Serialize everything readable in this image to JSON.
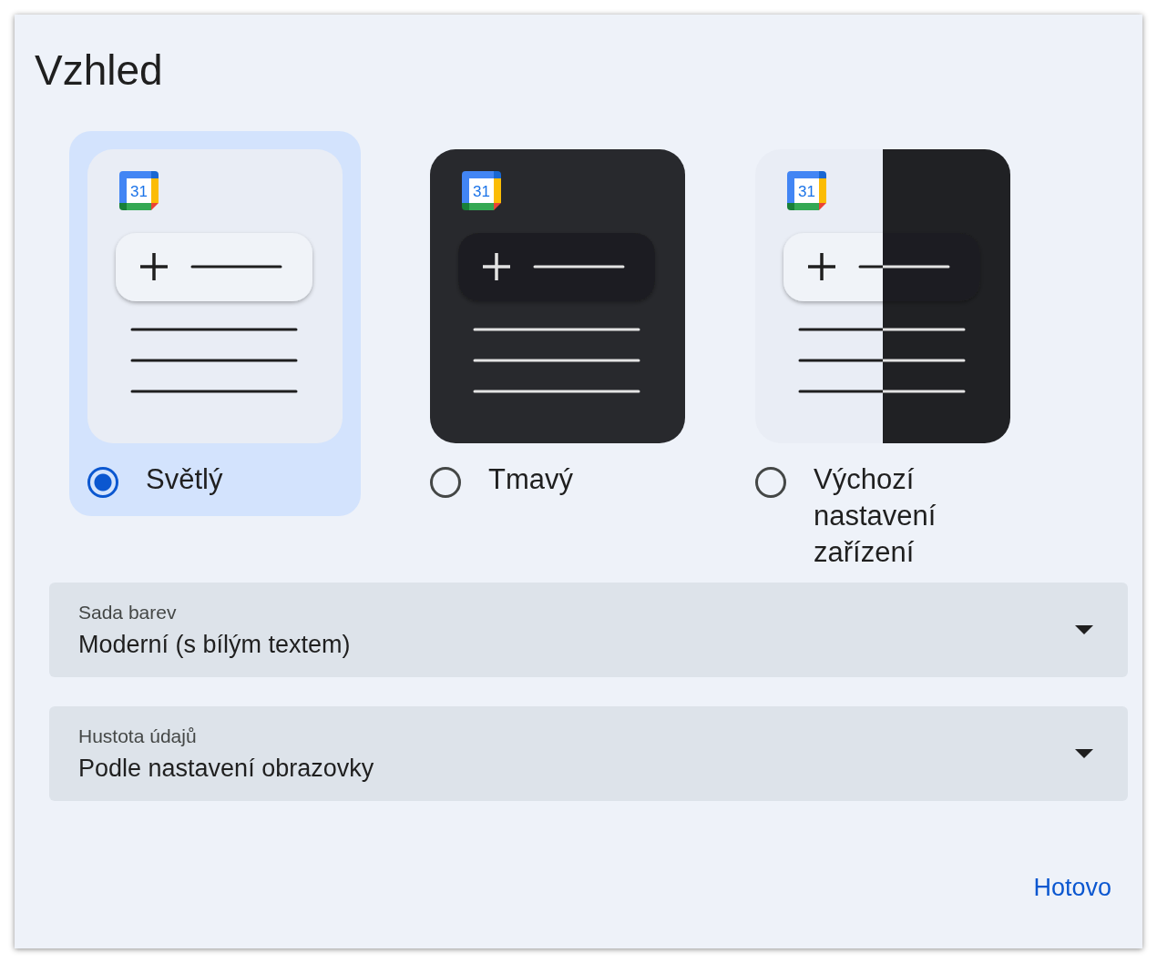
{
  "dialog": {
    "title": "Vzhled",
    "themes": [
      {
        "kind": "light",
        "label": "Světlý",
        "logo_text": "31",
        "selected": true
      },
      {
        "kind": "dark",
        "label": "Tmavý",
        "logo_text": "31",
        "selected": false
      },
      {
        "kind": "system",
        "label": "Výchozí nastavení zařízení",
        "logo_text": "31",
        "selected": false
      }
    ],
    "dropdowns": [
      {
        "label": "Sada barev",
        "value": "Moderní (s bílým textem)"
      },
      {
        "label": "Hustota údajů",
        "value": "Podle nastavení obrazovky"
      }
    ],
    "done_button": "Hotovo"
  }
}
